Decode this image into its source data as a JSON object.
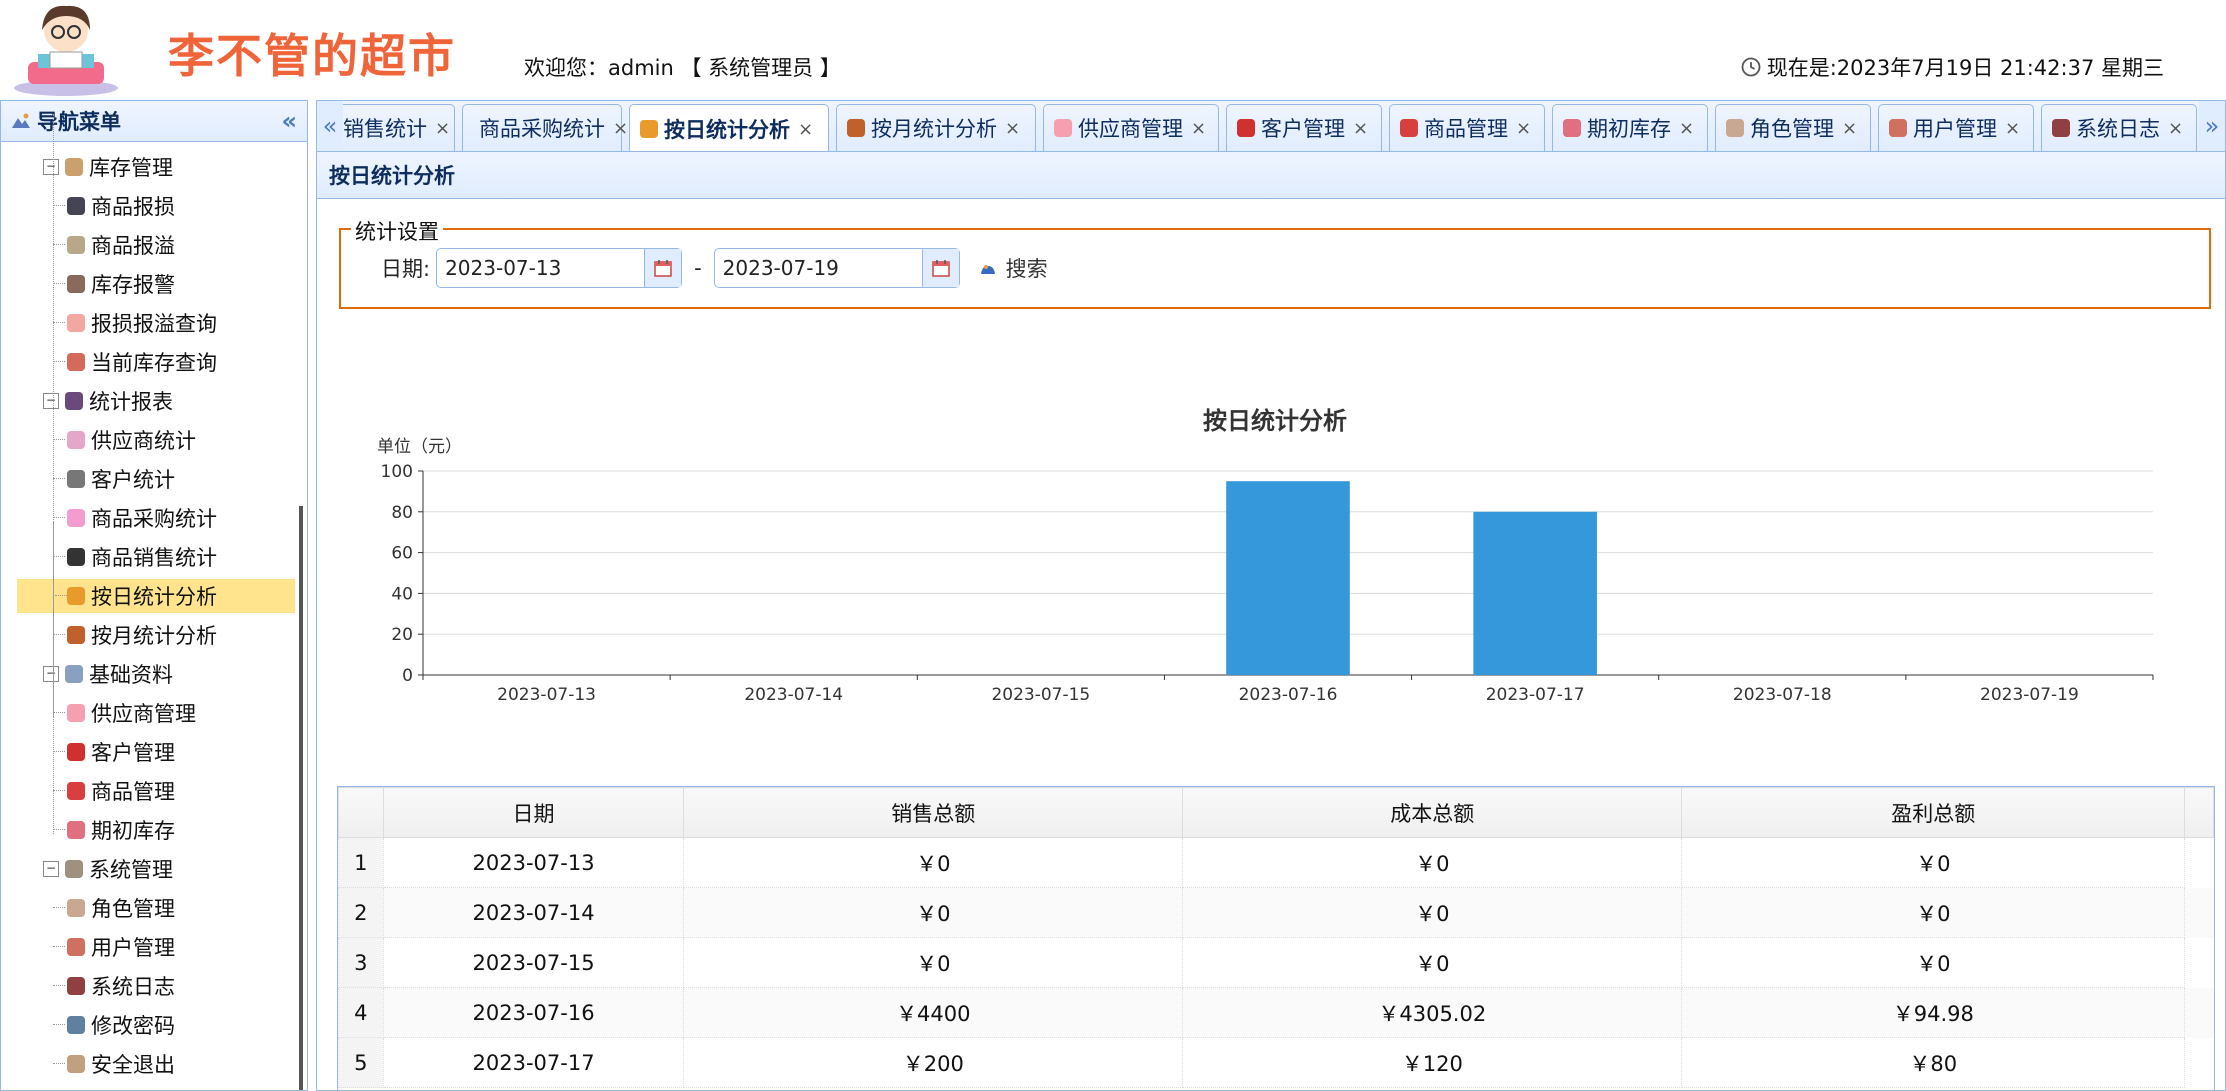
{
  "header": {
    "site_title": "李不管的超市",
    "welcome": "欢迎您：admin 【 系统管理员 】",
    "clock": "现在是:2023年7月19日 21:42:37 星期三"
  },
  "sidebar": {
    "title": "导航菜单",
    "nodes": [
      {
        "label": "库存管理",
        "level": 0,
        "icon_color": "#c9a06e",
        "icon": "box-icon"
      },
      {
        "label": "商品报损",
        "level": 1,
        "icon_color": "#445",
        "icon": "damage-icon"
      },
      {
        "label": "商品报溢",
        "level": 1,
        "icon_color": "#b9a78a",
        "icon": "overflow-icon"
      },
      {
        "label": "库存报警",
        "level": 1,
        "icon_color": "#8a6a5a",
        "icon": "alarm-icon"
      },
      {
        "label": "报损报溢查询",
        "level": 1,
        "icon_color": "#f2a7a0",
        "icon": "query-icon"
      },
      {
        "label": "当前库存查询",
        "level": 1,
        "icon_color": "#d46b5a",
        "icon": "stock-icon"
      },
      {
        "label": "统计报表",
        "level": 0,
        "icon_color": "#6a4a7a",
        "icon": "report-icon"
      },
      {
        "label": "供应商统计",
        "level": 1,
        "icon_color": "#e6a6c8",
        "icon": "supplier-stat-icon"
      },
      {
        "label": "客户统计",
        "level": 1,
        "icon_color": "#777",
        "icon": "customer-stat-icon"
      },
      {
        "label": "商品采购统计",
        "level": 1,
        "icon_color": "#f49bd0",
        "icon": "purchase-stat-icon"
      },
      {
        "label": "商品销售统计",
        "level": 1,
        "icon_color": "#333",
        "icon": "panda-icon"
      },
      {
        "label": "按日统计分析",
        "level": 1,
        "icon_color": "#e89a2a",
        "icon": "tiger-icon",
        "selected": true
      },
      {
        "label": "按月统计分析",
        "level": 1,
        "icon_color": "#c0602a",
        "icon": "monkey-icon"
      },
      {
        "label": "基础资料",
        "level": 0,
        "icon_color": "#8aa0c0",
        "icon": "data-icon"
      },
      {
        "label": "供应商管理",
        "level": 1,
        "icon_color": "#f4a0b0",
        "icon": "pig-icon"
      },
      {
        "label": "客户管理",
        "level": 1,
        "icon_color": "#d03030",
        "icon": "cherry-icon"
      },
      {
        "label": "商品管理",
        "level": 1,
        "icon_color": "#d84040",
        "icon": "goods-icon"
      },
      {
        "label": "期初库存",
        "level": 1,
        "icon_color": "#e07080",
        "icon": "initial-stock-icon"
      },
      {
        "label": "系统管理",
        "level": 0,
        "icon_color": "#a09080",
        "icon": "system-icon"
      },
      {
        "label": "角色管理",
        "level": 1,
        "icon_color": "#c8a890",
        "icon": "role-icon"
      },
      {
        "label": "用户管理",
        "level": 1,
        "icon_color": "#d07060",
        "icon": "user-icon"
      },
      {
        "label": "系统日志",
        "level": 1,
        "icon_color": "#904040",
        "icon": "log-icon"
      },
      {
        "label": "修改密码",
        "level": 1,
        "icon_color": "#6080a0",
        "icon": "password-icon"
      },
      {
        "label": "安全退出",
        "level": 1,
        "icon_color": "#c0a080",
        "icon": "logout-icon"
      }
    ]
  },
  "tabs": [
    {
      "label": "销售统计",
      "icon_color": "",
      "icon": "",
      "left": 8
    },
    {
      "label": "商品采购统计",
      "icon_color": "#f49bd0",
      "icon": "purchase-stat-icon"
    },
    {
      "label": "按日统计分析",
      "icon_color": "#e89a2a",
      "icon": "tiger-icon",
      "active": true
    },
    {
      "label": "按月统计分析",
      "icon_color": "#c0602a",
      "icon": "monkey-icon"
    },
    {
      "label": "供应商管理",
      "icon_color": "#f4a0b0",
      "icon": "pig-icon"
    },
    {
      "label": "客户管理",
      "icon_color": "#d03030",
      "icon": "cherry-icon"
    },
    {
      "label": "商品管理",
      "icon_color": "#d84040",
      "icon": "goods-icon"
    },
    {
      "label": "期初库存",
      "icon_color": "#e07080",
      "icon": "initial-stock-icon"
    },
    {
      "label": "角色管理",
      "icon_color": "#c8a890",
      "icon": "role-icon"
    },
    {
      "label": "用户管理",
      "icon_color": "#d07060",
      "icon": "user-icon"
    },
    {
      "label": "系统日志",
      "icon_color": "#904040",
      "icon": "log-icon"
    }
  ],
  "panel": {
    "title": "按日统计分析",
    "settings_legend": "统计设置",
    "date_label": "日期:",
    "date_from": "2023-07-13",
    "date_sep": "-",
    "date_to": "2023-07-19",
    "search_label": "搜索"
  },
  "chart_data": {
    "type": "bar",
    "title": "按日统计分析",
    "ylabel": "单位（元）",
    "xlabel": "",
    "categories": [
      "2023-07-13",
      "2023-07-14",
      "2023-07-15",
      "2023-07-16",
      "2023-07-17",
      "2023-07-18",
      "2023-07-19"
    ],
    "values": [
      0,
      0,
      0,
      95,
      80,
      0,
      0
    ],
    "ylim": [
      0,
      100
    ],
    "yticks": [
      0,
      20,
      40,
      60,
      80,
      100
    ],
    "grid": true,
    "bar_color": "#3498db"
  },
  "table": {
    "columns": [
      "日期",
      "销售总额",
      "成本总额",
      "盈利总额"
    ],
    "rows": [
      {
        "n": "1",
        "cells": [
          "2023-07-13",
          "￥0",
          "￥0",
          "￥0"
        ]
      },
      {
        "n": "2",
        "cells": [
          "2023-07-14",
          "￥0",
          "￥0",
          "￥0"
        ]
      },
      {
        "n": "3",
        "cells": [
          "2023-07-15",
          "￥0",
          "￥0",
          "￥0"
        ]
      },
      {
        "n": "4",
        "cells": [
          "2023-07-16",
          "￥4400",
          "￥4305.02",
          "￥94.98"
        ]
      },
      {
        "n": "5",
        "cells": [
          "2023-07-17",
          "￥200",
          "￥120",
          "￥80"
        ]
      }
    ]
  }
}
